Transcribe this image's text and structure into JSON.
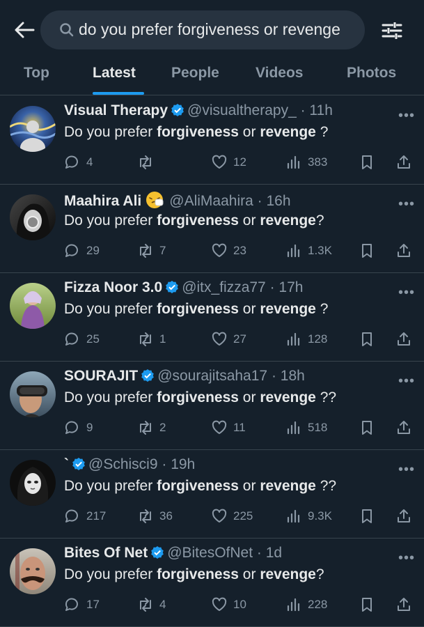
{
  "search": {
    "query": "do you prefer forgiveness or revenge"
  },
  "tabs": [
    {
      "label": "Top"
    },
    {
      "label": "Latest"
    },
    {
      "label": "People"
    },
    {
      "label": "Videos"
    },
    {
      "label": "Photos"
    }
  ],
  "colors": {
    "accent": "#1d9bf0",
    "background": "#15202b",
    "muted": "#8b98a5"
  },
  "tweets": [
    {
      "name": "Visual Therapy",
      "verified": true,
      "handle": "@visualtherapy_",
      "time": "11h",
      "text": {
        "pre": "Do you prefer ",
        "b1": "forgiveness",
        "mid": " or ",
        "b2": "revenge",
        "post": " ?"
      },
      "replies": "4",
      "retweets": "",
      "likes": "12",
      "views": "383"
    },
    {
      "name": "Maahira Ali",
      "verified": false,
      "emoji": "sneezing-face",
      "handle": "@AliMaahira",
      "time": "16h",
      "text": {
        "pre": "Do you prefer ",
        "b1": "forgiveness",
        "mid": " or ",
        "b2": "revenge",
        "post": "?"
      },
      "replies": "29",
      "retweets": "7",
      "likes": "23",
      "views": "1.3K"
    },
    {
      "name": "Fizza Noor 3.0",
      "verified": true,
      "handle": "@itx_fizza77",
      "time": "17h",
      "text": {
        "pre": "Do you prefer ",
        "b1": "forgiveness",
        "mid": " or ",
        "b2": "revenge",
        "post": " ?"
      },
      "replies": "25",
      "retweets": "1",
      "likes": "27",
      "views": "128"
    },
    {
      "name": "SOURAJIT",
      "verified": true,
      "handle": "@sourajitsaha17",
      "time": "18h",
      "text": {
        "pre": "Do you prefer ",
        "b1": "forgiveness",
        "mid": " or ",
        "b2": "revenge",
        "post": " ??"
      },
      "replies": "9",
      "retweets": "2",
      "likes": "11",
      "views": "518"
    },
    {
      "name": "`",
      "verified": true,
      "handle": "@Schisci9",
      "time": "19h",
      "text": {
        "pre": "Do you prefer ",
        "b1": "forgiveness",
        "mid": " or ",
        "b2": "revenge",
        "post": " ??"
      },
      "replies": "217",
      "retweets": "36",
      "likes": "225",
      "views": "9.3K"
    },
    {
      "name": "Bites Of Net",
      "verified": true,
      "handle": "@BitesOfNet",
      "time": "1d",
      "text": {
        "pre": "Do you prefer ",
        "b1": "forgiveness",
        "mid": " or ",
        "b2": "revenge",
        "post": "?"
      },
      "replies": "17",
      "retweets": "4",
      "likes": "10",
      "views": "228"
    }
  ]
}
